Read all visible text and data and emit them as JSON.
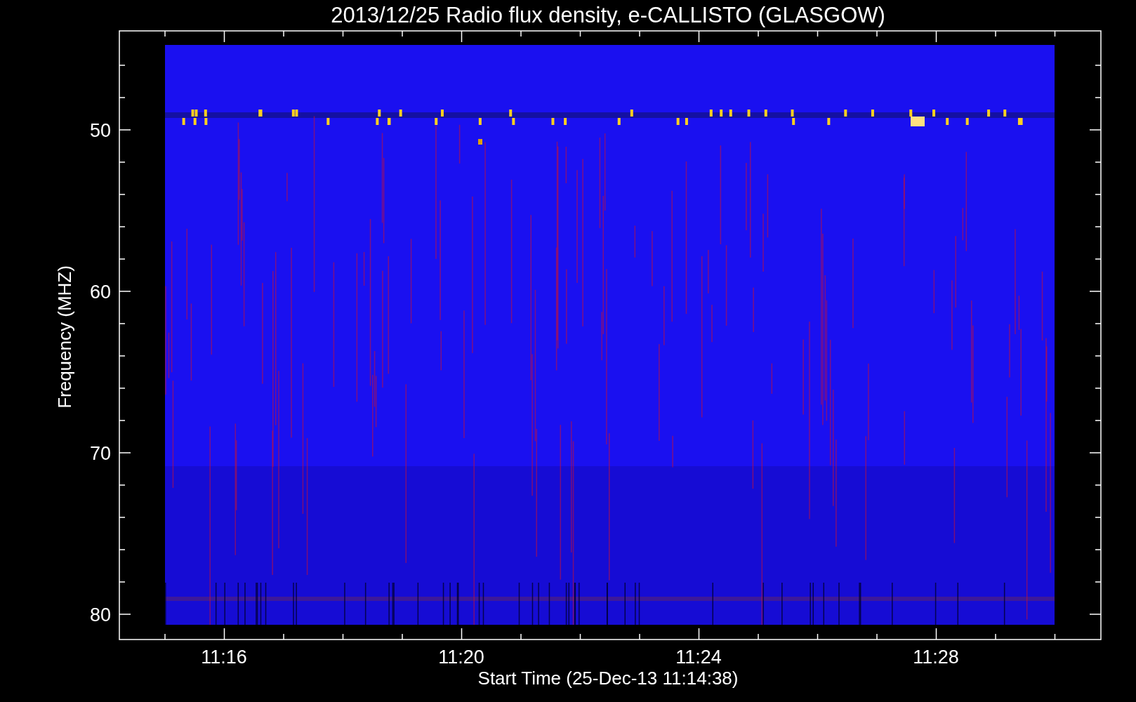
{
  "title": "2013/12/25  Radio flux density, e-CALLISTO (GLASGOW)",
  "y_axis": {
    "label": "Frequency (MHZ)",
    "tick_labels": [
      "50",
      "60",
      "70",
      "80"
    ]
  },
  "x_axis": {
    "label": "Start Time (25-Dec-13 11:14:38)",
    "tick_labels": [
      "11:16",
      "11:20",
      "11:24",
      "11:28"
    ]
  }
}
